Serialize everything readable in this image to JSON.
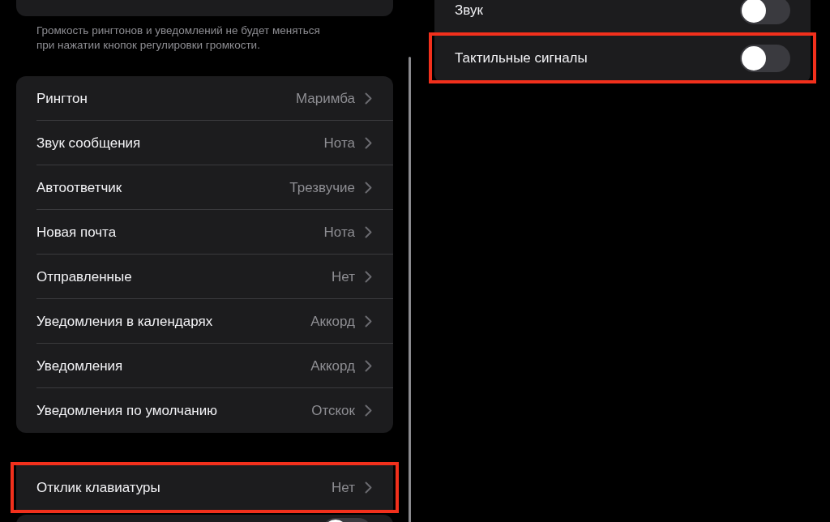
{
  "left": {
    "footnote": "Громкость рингтонов и уведомлений не будет меняться при нажатии кнопок регулировки громкости.",
    "sounds": [
      {
        "label": "Рингтон",
        "value": "Маримба"
      },
      {
        "label": "Звук сообщения",
        "value": "Нота"
      },
      {
        "label": "Автоответчик",
        "value": "Трезвучие"
      },
      {
        "label": "Новая почта",
        "value": "Нота"
      },
      {
        "label": "Отправленные",
        "value": "Нет"
      },
      {
        "label": "Уведомления в календарях",
        "value": "Аккорд"
      },
      {
        "label": "Уведомления",
        "value": "Аккорд"
      },
      {
        "label": "Уведомления по умолчанию",
        "value": "Отскок"
      }
    ],
    "keyboard": {
      "label": "Отклик клавиатуры",
      "value": "Нет",
      "highlighted": true
    },
    "next_toggle": {
      "on": false
    }
  },
  "right": {
    "toggles": [
      {
        "label": "Звук",
        "on": false,
        "highlighted": false
      },
      {
        "label": "Тактильные сигналы",
        "on": false,
        "highlighted": true
      }
    ]
  }
}
